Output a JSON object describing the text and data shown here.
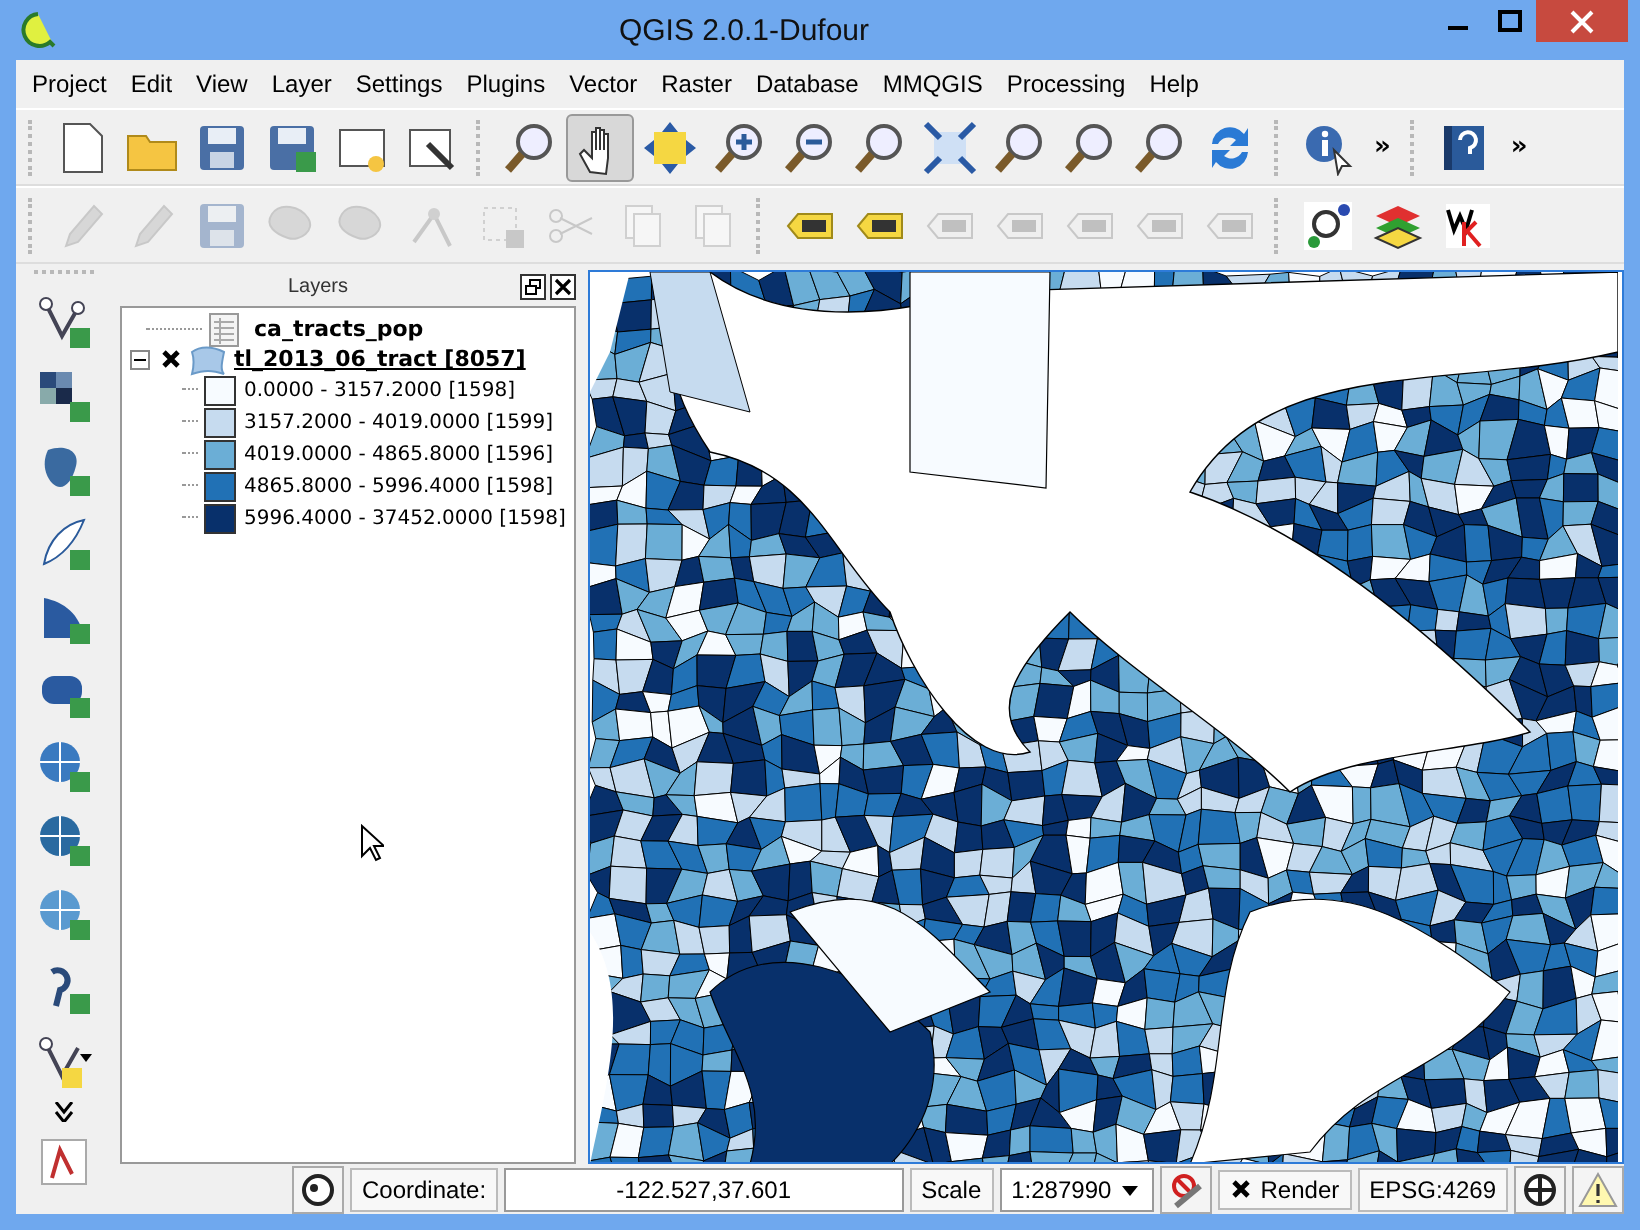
{
  "window": {
    "title": "QGIS 2.0.1-Dufour"
  },
  "menu": [
    "Project",
    "Edit",
    "View",
    "Layer",
    "Settings",
    "Plugins",
    "Vector",
    "Raster",
    "Database",
    "MMQGIS",
    "Processing",
    "Help"
  ],
  "toolbar_main": {
    "buttons": [
      {
        "selected": false
      },
      {
        "selected": false
      },
      {
        "selected": false
      },
      {
        "selected": false
      },
      {
        "selected": false
      },
      {
        "selected": false
      },
      {
        "selected": false
      },
      {
        "selected": true
      },
      {
        "selected": false
      },
      {
        "selected": false
      },
      {
        "selected": false
      },
      {
        "selected": false
      },
      {
        "selected": false
      },
      {
        "selected": false
      },
      {
        "selected": false
      },
      {
        "selected": false
      },
      {
        "selected": false
      }
    ],
    "overflow": "»",
    "help_overflow": "»"
  },
  "toolbar_edit": {
    "buttons": [
      {
        "disabled": true
      },
      {
        "disabled": true
      },
      {
        "disabled": true
      },
      {
        "disabled": true
      },
      {
        "disabled": true
      },
      {
        "disabled": true
      },
      {
        "disabled": true
      },
      {
        "disabled": true
      },
      {
        "disabled": true
      },
      {
        "disabled": true
      },
      {
        "disabled": false
      },
      {
        "disabled": false
      },
      {
        "disabled": true
      },
      {
        "disabled": true
      },
      {
        "disabled": true
      },
      {
        "disabled": true
      },
      {
        "disabled": true
      },
      {
        "disabled": false
      },
      {
        "disabled": false
      },
      {
        "disabled": false
      }
    ]
  },
  "layers_panel": {
    "title": "Layers",
    "layers": [
      {
        "kind": "table",
        "name": "ca_tracts_pop"
      },
      {
        "kind": "vector",
        "name": "tl_2013_06_tract [8057]",
        "expanded": true,
        "visible": true,
        "children": [
          {
            "label": "0.0000 - 3157.2000 [1598]",
            "color": "#f7fbff"
          },
          {
            "label": "3157.2000 - 4019.0000 [1599]",
            "color": "#c6dbef"
          },
          {
            "label": "4019.0000 - 4865.8000 [1596]",
            "color": "#6baed6"
          },
          {
            "label": "4865.8000 - 5996.4000 [1598]",
            "color": "#2171b5"
          },
          {
            "label": "5996.4000 - 37452.0000 [1598]",
            "color": "#08306b"
          }
        ]
      }
    ]
  },
  "status_bar": {
    "coordinate_label": "Coordinate:",
    "coordinate": "-122.527,37.601",
    "scale_label": "Scale",
    "scale": "1:287990",
    "render": {
      "label": "Render",
      "checked": true
    },
    "crs": "EPSG:4269"
  }
}
